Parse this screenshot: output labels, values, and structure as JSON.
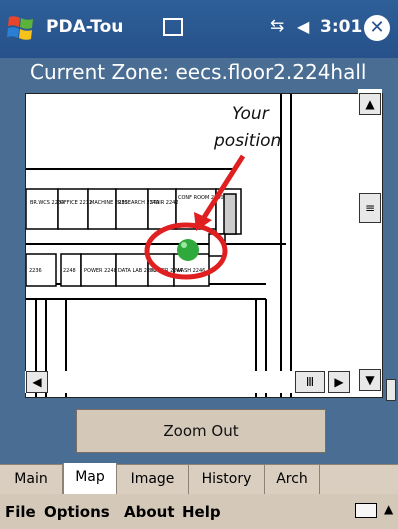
{
  "titlebar": {
    "app_title": "PDA-Tou",
    "time": "3:01",
    "close_label": "✕",
    "icons": [
      "windows-start-icon",
      "keyboard-tray-icon",
      "connectivity-icon",
      "volume-icon",
      "close-icon"
    ]
  },
  "zone": {
    "label": "Current Zone: eecs.floor2.224hall"
  },
  "map": {
    "annotation_line1": "Your",
    "annotation_line2": "position",
    "rooms": [
      "BR.WCS 2234",
      "OFFICE 2232",
      "MACHINE 2230",
      "RESEARCH 2240",
      "STAIR 2242",
      "CONF ROOM 2250",
      "2236",
      "2248",
      "POWER 2248",
      "DATA LAB 2252",
      "POWER 2244",
      "WASH 2246"
    ],
    "marker_color": "#2fa83c",
    "circle_color": "#e02020"
  },
  "scroll": {
    "up": "▲",
    "down": "▼",
    "left": "◀",
    "right": "▶"
  },
  "zoom_button": {
    "label": "Zoom Out"
  },
  "tabs": [
    {
      "label": "Main",
      "active": false
    },
    {
      "label": "Map",
      "active": true
    },
    {
      "label": "Image",
      "active": false
    },
    {
      "label": "History",
      "active": false
    },
    {
      "label": "Arch",
      "active": false
    }
  ],
  "menu": {
    "file": "File",
    "options": "Options",
    "about": "About",
    "help": "Help",
    "sip_arrow": "▲"
  }
}
